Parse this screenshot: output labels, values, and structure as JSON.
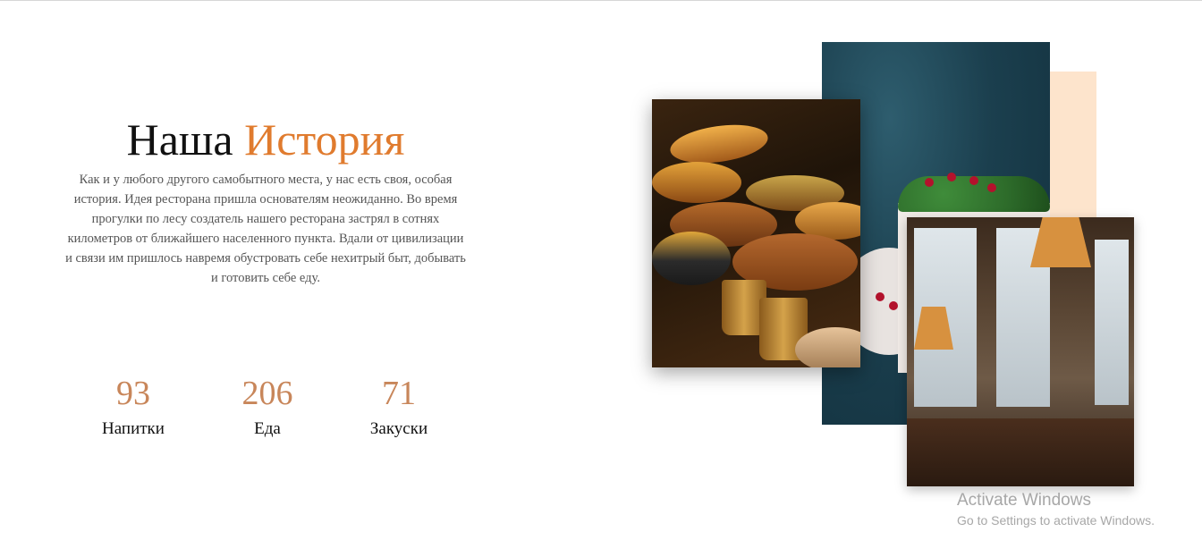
{
  "about": {
    "title_main": "Наша",
    "title_accent": "История",
    "story": "Как и у любого другого самобытного места, у нас есть своя, особая история. Идея ресторана пришла основателям неожиданно. Во время прогулки по лесу создатель нашего ресторана застрял в сотнях километров от ближайшего населенного пункта. Вдали от цивилизации и связи им пришлось навремя обустровать себе нехитрый быт, добывать и готовить себе еду."
  },
  "stats": [
    {
      "value": "93",
      "label": "Напитки"
    },
    {
      "value": "206",
      "label": "Еда"
    },
    {
      "value": "71",
      "label": "Закуски"
    }
  ],
  "gallery": {
    "images": [
      "indian-food-photo",
      "cake-photo",
      "cafe-interior-photo"
    ],
    "accent_color": "#fde4cc"
  },
  "colors": {
    "title_accent": "#e07b2e",
    "stat_number": "#c8865a"
  },
  "watermark": {
    "line1": "Activate Windows",
    "line2": "Go to Settings to activate Windows."
  }
}
